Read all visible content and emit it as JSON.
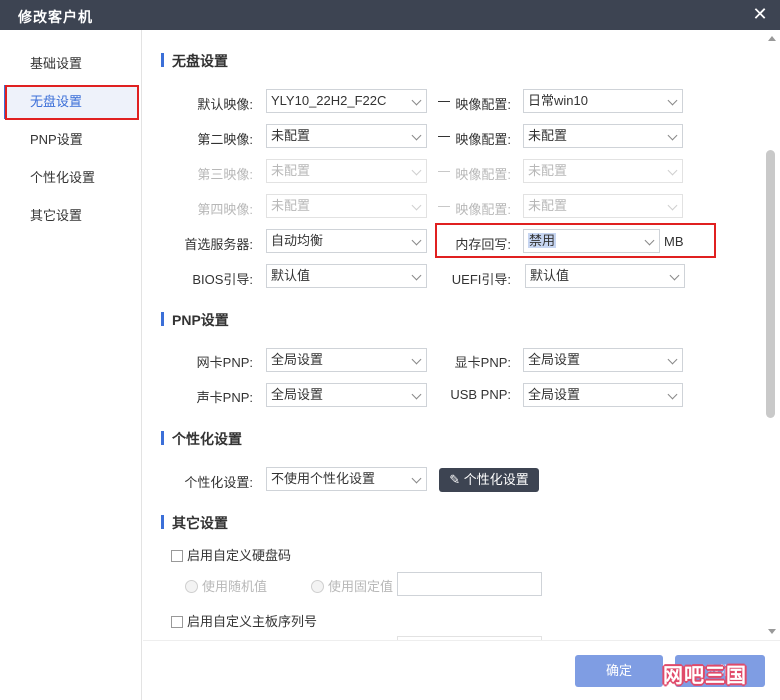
{
  "window": {
    "title": "修改客户机"
  },
  "sidebar": {
    "items": [
      {
        "label": "基础设置",
        "active": false
      },
      {
        "label": "无盘设置",
        "active": true
      },
      {
        "label": "PNP设置",
        "active": false
      },
      {
        "label": "个性化设置",
        "active": false
      },
      {
        "label": "其它设置",
        "active": false
      }
    ]
  },
  "diskless": {
    "title": "无盘设置",
    "rows": [
      {
        "left_label": "默认映像:",
        "left_value": "YLY10_22H2_F22C",
        "right_label": "映像配置:",
        "right_value": "日常win10",
        "disabled": false
      },
      {
        "left_label": "第二映像:",
        "left_value": "未配置",
        "right_label": "映像配置:",
        "right_value": "未配置",
        "disabled": false
      },
      {
        "left_label": "第三映像:",
        "left_value": "未配置",
        "right_label": "映像配置:",
        "right_value": "未配置",
        "disabled": true
      },
      {
        "left_label": "第四映像:",
        "left_value": "未配置",
        "right_label": "映像配置:",
        "right_value": "未配置",
        "disabled": true
      }
    ],
    "server_label": "首选服务器:",
    "server_value": "自动均衡",
    "mem_label": "内存回写:",
    "mem_value": "禁用",
    "mem_unit": "MB",
    "bios_label": "BIOS引导:",
    "bios_value": "默认值",
    "uefi_label": "UEFI引导:",
    "uefi_value": "默认值"
  },
  "pnp": {
    "title": "PNP设置",
    "nic_label": "网卡PNP:",
    "nic_value": "全局设置",
    "gpu_label": "显卡PNP:",
    "gpu_value": "全局设置",
    "audio_label": "声卡PNP:",
    "audio_value": "全局设置",
    "usb_label": "USB PNP:",
    "usb_value": "全局设置"
  },
  "personal": {
    "title": "个性化设置",
    "label": "个性化设置:",
    "value": "不使用个性化设置",
    "button": "个性化设置"
  },
  "other": {
    "title": "其它设置",
    "disk_code_check": "启用自定义硬盘码",
    "radio_random": "使用随机值",
    "radio_fixed": "使用固定值",
    "fixed_value": "",
    "board_serial_check": "启用自定义主板序列号"
  },
  "footer": {
    "ok": "确定",
    "cancel": "取消",
    "watermark": "网吧三国"
  },
  "colors": {
    "accent": "#3b6fd8",
    "titlebar": "#3d4452",
    "highlight_box": "#e02020",
    "button": "#7f9de3"
  }
}
